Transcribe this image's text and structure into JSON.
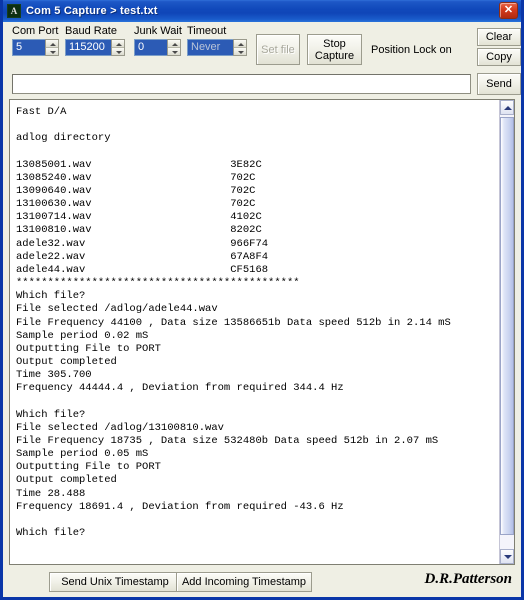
{
  "window": {
    "title": "Com  5 Capture > test.txt",
    "icon_name": "app-icon",
    "close_label": "✕"
  },
  "toolbar": {
    "com_port": {
      "label": "Com Port",
      "value": "5"
    },
    "baud_rate": {
      "label": "Baud Rate",
      "value": "115200"
    },
    "junk_wait": {
      "label": "Junk Wait",
      "value": "0"
    },
    "timeout": {
      "label": "Timeout",
      "value": "Never"
    },
    "set_file_label": "Set file",
    "stop_capture_label": "Stop\nCapture",
    "position_lock_label": "Position Lock on",
    "clear_label": "Clear",
    "copy_label": "Copy"
  },
  "send_row": {
    "input_value": "",
    "input_placeholder": "",
    "send_label": "Send"
  },
  "console": {
    "text": "Fast D/A\n\nadlog directory\n\n13085001.wav                      3E82C\n13085240.wav                      702C\n13090640.wav                      702C\n13100630.wav                      702C\n13100714.wav                      4102C\n13100810.wav                      8202C\nadele32.wav                       966F74\nadele22.wav                       67A8F4\nadele44.wav                       CF5168\n*********************************************\nWhich file?\nFile selected /adlog/adele44.wav\nFile Frequency 44100 , Data size 13586651b Data speed 512b in 2.14 mS\nSample period 0.02 mS\nOutputting File to PORT\nOutput completed\nTime 305.700\nFrequency 44444.4 , Deviation from required 344.4 Hz\n\nWhich file?\nFile selected /adlog/13100810.wav\nFile Frequency 18735 , Data size 532480b Data speed 512b in 2.07 mS\nSample period 0.05 mS\nOutputting File to PORT\nOutput completed\nTime 28.488\nFrequency 18691.4 , Deviation from required -43.6 Hz\n\nWhich file?"
  },
  "bottom": {
    "send_unix_timestamp_label": "Send Unix Timestamp",
    "add_incoming_timestamp_label": "Add Incoming Timestamp",
    "signature": "D.R.Patterson"
  },
  "colors": {
    "title_bar": "#1149bb",
    "close_button": "#d33a1c",
    "form_background": "#efefe4",
    "console_background": "#ffffff",
    "field_selected": "#2c5bb5"
  }
}
